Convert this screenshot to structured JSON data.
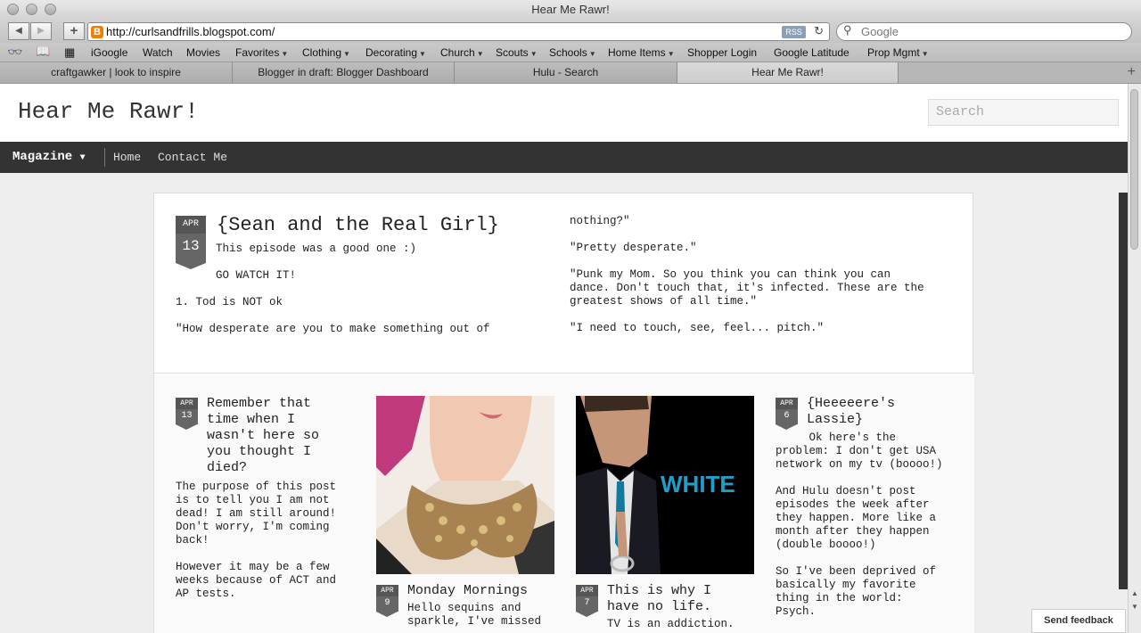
{
  "window": {
    "title": "Hear Me Rawr!"
  },
  "toolbar": {
    "back_label": "◀",
    "forward_label": "▶",
    "add_label": "+",
    "url": "http://curlsandfrills.blogspot.com/",
    "rss_label": "RSS",
    "search_placeholder": "Google"
  },
  "bookmarks": {
    "items": [
      {
        "label": "iGoogle",
        "menu": false
      },
      {
        "label": "Watch",
        "menu": false
      },
      {
        "label": "Movies",
        "menu": false
      },
      {
        "label": "Favorites",
        "menu": true
      },
      {
        "label": "Clothing",
        "menu": true
      },
      {
        "label": "Decorating",
        "menu": true
      },
      {
        "label": "Church",
        "menu": true
      },
      {
        "label": "Scouts",
        "menu": true
      },
      {
        "label": "Schools",
        "menu": true
      },
      {
        "label": "Home Items",
        "menu": true
      },
      {
        "label": "Shopper Login",
        "menu": false
      },
      {
        "label": "Google Latitude",
        "menu": false
      },
      {
        "label": "Prop Mgmt",
        "menu": true
      }
    ]
  },
  "tabs": [
    {
      "label": "craftgawker | look to inspire",
      "active": false
    },
    {
      "label": "Blogger in draft: Blogger Dashboard",
      "active": false
    },
    {
      "label": "Hulu - Search",
      "active": false
    },
    {
      "label": "Hear Me Rawr!",
      "active": true
    }
  ],
  "blog": {
    "title": "Hear Me Rawr!",
    "search_placeholder": "Search",
    "nav": {
      "magazine": "Magazine",
      "home": "Home",
      "contact": "Contact Me"
    },
    "featured": {
      "month": "APR",
      "day": "13",
      "title": "{Sean and the Real Girl}",
      "col1": [
        "This episode was a good one :)",
        "GO WATCH IT!",
        "1. Tod is NOT ok",
        "\"How desperate are you to make something out of"
      ],
      "col2": [
        "nothing?\"",
        "\"Pretty desperate.\"",
        "\"Punk my Mom. So you think you can think you can\ndance. Don't touch that, it's infected. These are the\ngreatest shows of all time.\"",
        "\"I need to touch, see, feel... pitch.\""
      ]
    },
    "posts": [
      {
        "month": "APR",
        "day": "13",
        "title": "Remember that\ntime when I\nwasn't here so\nyou thought I\ndied?",
        "excerpt": "The purpose of this post\nis to tell you I am not\ndead! I am still around!\nDon't worry, I'm coming\nback!\n\nHowever it may be a few\nweeks because of ACT and\nAP tests."
      },
      {
        "month": "APR",
        "day": "9",
        "title": "Monday Mornings",
        "excerpt": "Hello sequins and\nsparkle, I've missed"
      },
      {
        "month": "APR",
        "day": "7",
        "title": "This is why I\nhave no life.",
        "excerpt": "TV is an addiction.",
        "image_text": "WHITE"
      },
      {
        "month": "APR",
        "day": "6",
        "title": "{Heeeeere's\nLassie}",
        "excerpt": "     Ok here's the\nproblem: I don't get USA\nnetwork on my tv (boooo!)\n\nAnd Hulu doesn't post\nepisodes the week after\nthey happen. More like a\nmonth after they happen\n(double boooo!)\n\nSo I've been deprived of\nbasically my favorite\nthing in the world:\nPsych."
      }
    ],
    "send_feedback": "Send feedback"
  }
}
